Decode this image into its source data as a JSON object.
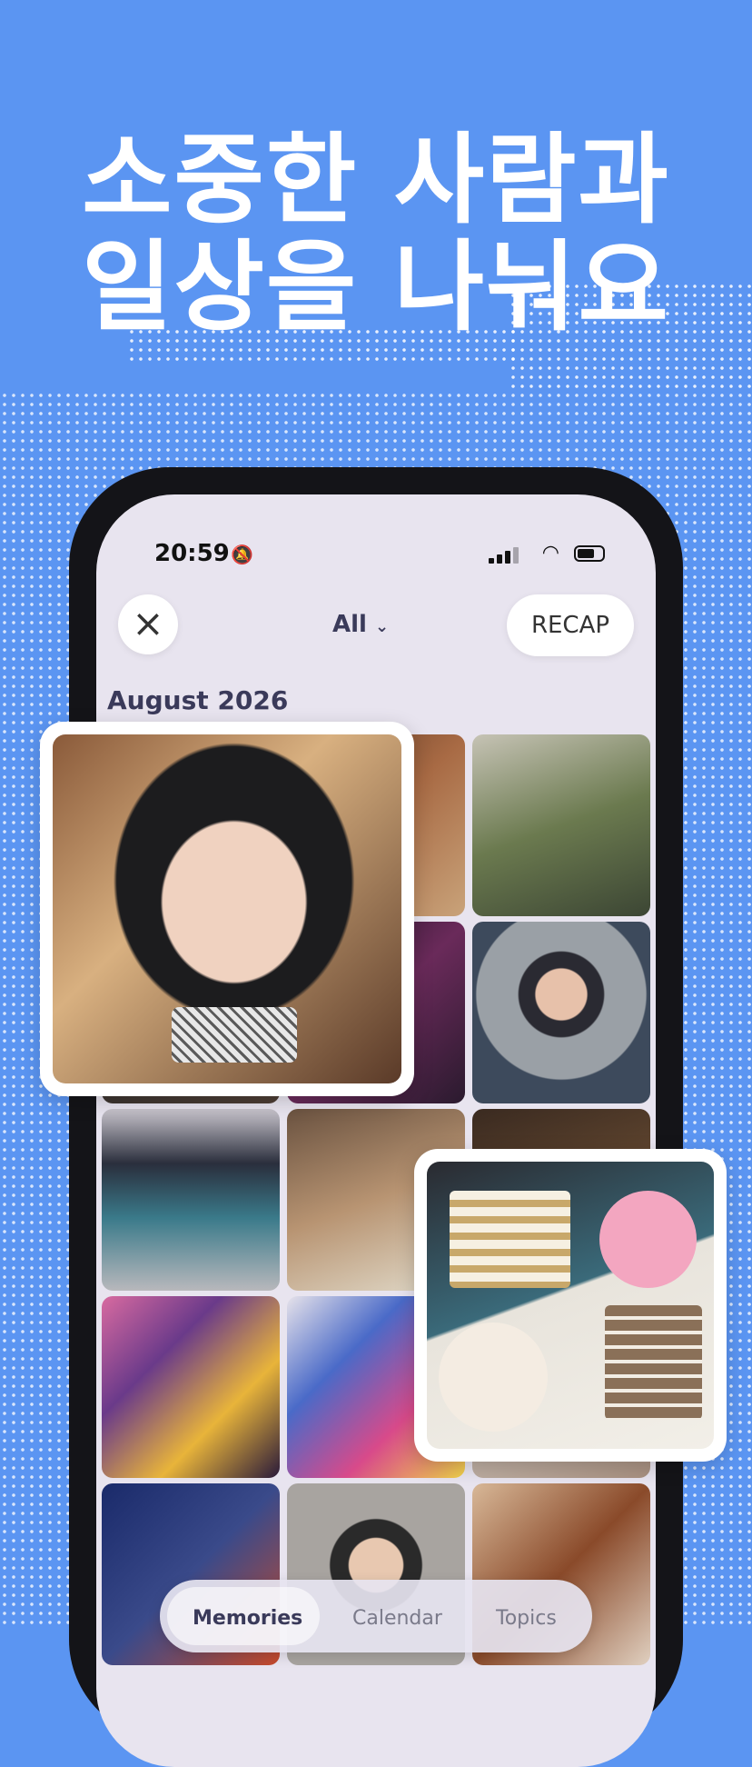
{
  "headline": {
    "line1": "소중한 사람과",
    "line2": "일상을 나눠요"
  },
  "status_bar": {
    "time": "20:59",
    "bell_icon": "bell-slash-icon",
    "battery_level": 0.55
  },
  "top_bar": {
    "close_icon": "close-icon",
    "filter_label": "All",
    "filter_icon": "chevron-down-icon",
    "recap_label": "RECAP"
  },
  "section": {
    "month": "August 2026"
  },
  "photos": {
    "grid": [
      {
        "desc": "cafe interior"
      },
      {
        "desc": "restaurant table"
      },
      {
        "desc": "narrow alley"
      },
      {
        "desc": "portrait"
      },
      {
        "desc": "neon bar"
      },
      {
        "desc": "portrait smiling"
      },
      {
        "desc": "laptop editing"
      },
      {
        "desc": "food plate"
      },
      {
        "desc": "cake table"
      },
      {
        "desc": "arcade"
      },
      {
        "desc": "toy boxes"
      },
      {
        "desc": "plush toys"
      },
      {
        "desc": "store front"
      },
      {
        "desc": "selfie headphones"
      },
      {
        "desc": "korean dinner"
      }
    ]
  },
  "tabs": [
    {
      "label": "Memories",
      "active": true
    },
    {
      "label": "Calendar",
      "active": false
    },
    {
      "label": "Topics",
      "active": false
    }
  ],
  "colors": {
    "background": "#5b95f2",
    "screen": "#e8e4ef",
    "accent_text": "#3a3a5a"
  }
}
